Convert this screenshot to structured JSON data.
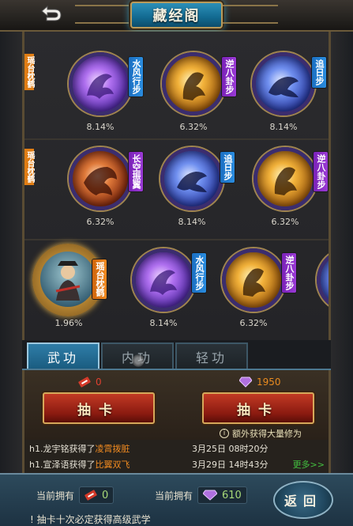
{
  "header": {
    "title": "藏经阁",
    "back_icon": "back-arrow-icon"
  },
  "cards": [
    {
      "row": 0,
      "label": "水风行步",
      "pct": "8.14%",
      "orb": "violet",
      "tag": "blue"
    },
    {
      "row": 0,
      "label": "逆八卦步",
      "pct": "6.32%",
      "orb": "gold",
      "tag": "purple"
    },
    {
      "row": 0,
      "label": "追日步",
      "pct": "8.14%",
      "orb": "blue",
      "tag": "blue"
    },
    {
      "row": 1,
      "label": "长空振翼",
      "pct": "6.32%",
      "orb": "red",
      "tag": "purple"
    },
    {
      "row": 1,
      "label": "追日步",
      "pct": "8.14%",
      "orb": "blue",
      "tag": "blue"
    },
    {
      "row": 1,
      "label": "逆八卦步",
      "pct": "6.32%",
      "orb": "gold",
      "tag": "purple"
    },
    {
      "row": 2,
      "label": "瑶台枕鹤",
      "pct": "1.96%",
      "orb": "dragon",
      "tag": "orange"
    },
    {
      "row": 2,
      "label": "水风行步",
      "pct": "8.14%",
      "orb": "violet",
      "tag": "blue"
    },
    {
      "row": 2,
      "label": "逆八卦步",
      "pct": "6.32%",
      "orb": "gold",
      "tag": "purple"
    }
  ],
  "partial_left": {
    "row0": "瑶台枕鹤",
    "row1": "瑶台枕鹤"
  },
  "tabs": {
    "wugong": "武功",
    "neigong": "内功",
    "qinggong": "轻功"
  },
  "draw": {
    "left_cost": "0",
    "right_cost": "1950",
    "left_button": "抽卡",
    "right_button": "抽卡",
    "tip": "额外获得大量修为",
    "tip_icon": "info-icon"
  },
  "log": [
    {
      "name": "h1.龙宇铭获得了",
      "item": "凌霄拨脏",
      "date": "3月25日 08时20分"
    },
    {
      "name": "h1.宣泽语获得了",
      "item": "比翼双飞",
      "date": "3月29日 14时43分"
    }
  ],
  "more": "更多>>",
  "bottom": {
    "own_label_1": "当前拥有",
    "own_value_1": "0",
    "own_label_2": "当前拥有",
    "own_value_2": "610",
    "notice": "! 抽卡十次必定获得高级武学",
    "return": "返回"
  }
}
